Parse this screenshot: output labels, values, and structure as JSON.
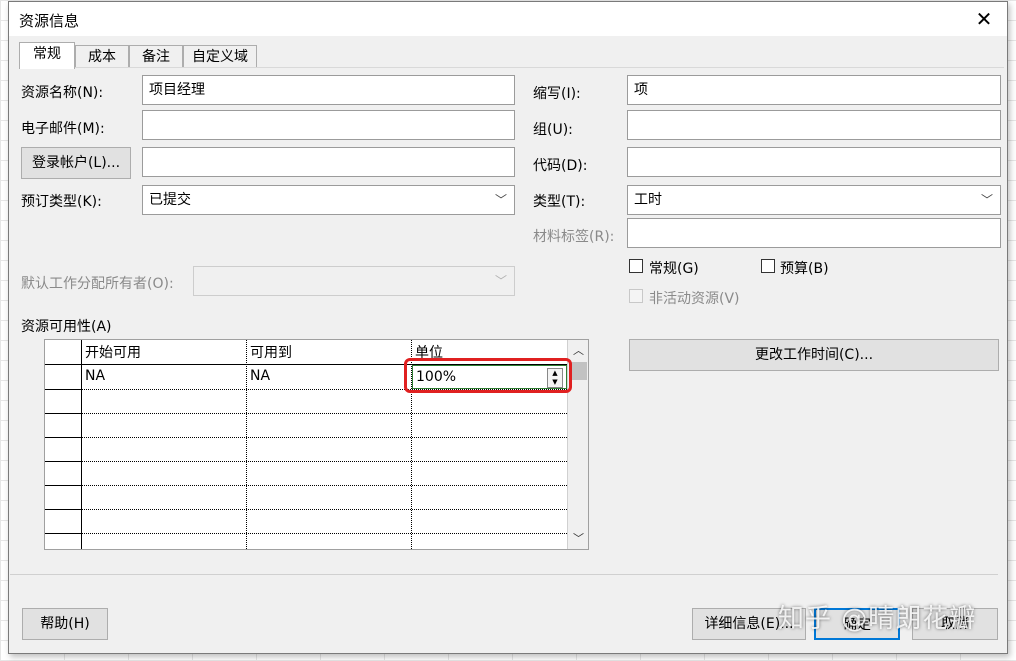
{
  "dialog": {
    "title": "资源信息",
    "close_glyph": "✕"
  },
  "tabs": [
    "常规",
    "成本",
    "备注",
    "自定义域"
  ],
  "fields": {
    "name_label": "资源名称(N):",
    "name_value": "项目经理",
    "email_label": "电子邮件(M):",
    "email_value": "",
    "login_button": "登录帐户(L)...",
    "login_value": "",
    "booking_label": "预订类型(K):",
    "booking_value": "已提交",
    "owner_label": "默认工作分配所有者(O):",
    "owner_value": "",
    "initials_label": "缩写(I):",
    "initials_value": "项",
    "group_label": "组(U):",
    "group_value": "",
    "code_label": "代码(D):",
    "code_value": "",
    "type_label": "类型(T):",
    "type_value": "工时",
    "material_label": "材料标签(R):",
    "material_value": ""
  },
  "checkboxes": {
    "generic": "常规(G)",
    "budget": "预算(B)",
    "inactive": "非活动资源(V)"
  },
  "availability": {
    "label": "资源可用性(A)",
    "columns": [
      "开始可用",
      "可用到",
      "单位"
    ],
    "rows": [
      {
        "start": "NA",
        "end": "NA",
        "units": "100%"
      }
    ]
  },
  "buttons": {
    "change_working_time": "更改工作时间(C)...",
    "help": "帮助(H)",
    "details": "详细信息(E)...",
    "ok": "确定",
    "cancel": "取消"
  },
  "watermark": "知乎 @晴朗花瓣"
}
